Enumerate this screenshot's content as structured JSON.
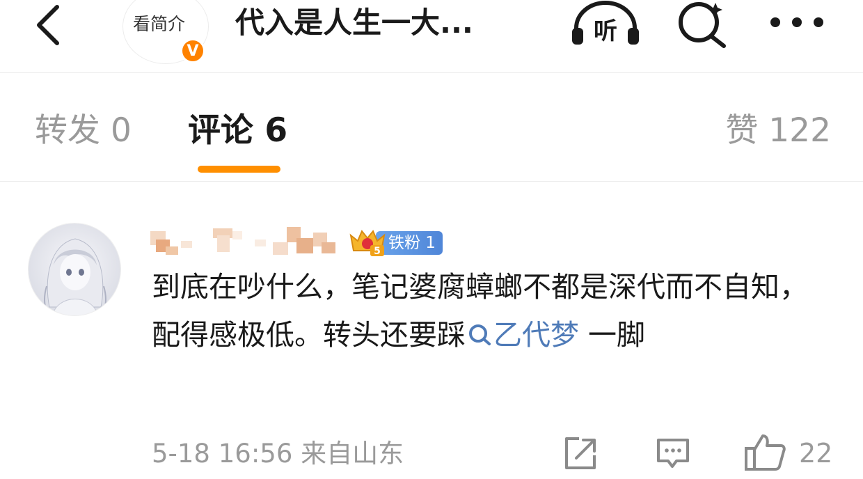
{
  "header": {
    "profile_pill_label": "看简介",
    "verified_badge": "V",
    "title": "代入是人生一大...",
    "listen_label": "听",
    "icons": [
      "back-icon",
      "headphones-icon",
      "search-icon",
      "more-icon"
    ]
  },
  "tabs": {
    "repost": "转发 0",
    "comment": "评论 6",
    "like": "赞 122"
  },
  "comment": {
    "fan_badge_level": "5",
    "fan_badge": "铁粉 1",
    "text_before": "到底在吵什么，笔记婆腐蟑螂不都是深代而不自知，配得感极低。转头还要踩",
    "topic": "乙代梦",
    "text_after": " 一脚",
    "time": "5-18 16:56",
    "location": "来自山东",
    "like_count": "22"
  },
  "colors": {
    "accent_orange": "#ff8f00",
    "verified_orange": "#ff8200",
    "link_blue": "#4f7bb8",
    "muted_gray": "#9a9a9a"
  }
}
